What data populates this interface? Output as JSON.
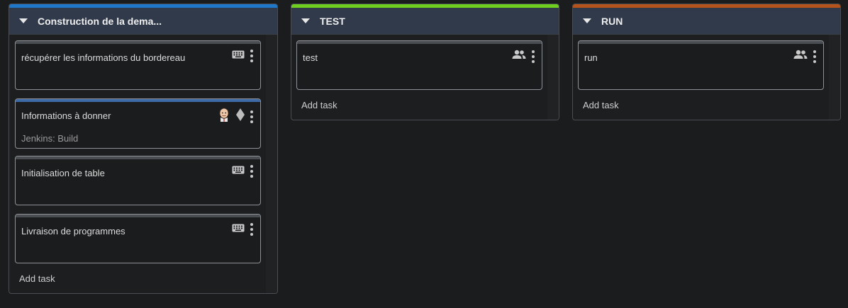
{
  "columns": [
    {
      "title": "Construction de la dema...",
      "accent": "#1e77c8",
      "add_task": "Add task",
      "cards": [
        {
          "name": "récupérer les informations du bordereau",
          "icon": "keyboard-icon"
        },
        {
          "name": "Informations à donner",
          "subtitle": "Jenkins: Build",
          "icons": [
            "jenkins-icon",
            "git-icon"
          ]
        },
        {
          "name": "Initialisation de table",
          "icon": "keyboard-icon"
        },
        {
          "name": "Livraison de programmes",
          "icon": "keyboard-icon"
        }
      ]
    },
    {
      "title": "TEST",
      "accent": "#6fcf1e",
      "add_task": "Add task",
      "cards": [
        {
          "name": "test",
          "icon": "users-icon"
        }
      ]
    },
    {
      "title": "RUN",
      "accent": "#b5531a",
      "add_task": "Add task",
      "cards": [
        {
          "name": "run",
          "icon": "users-icon"
        }
      ]
    }
  ]
}
